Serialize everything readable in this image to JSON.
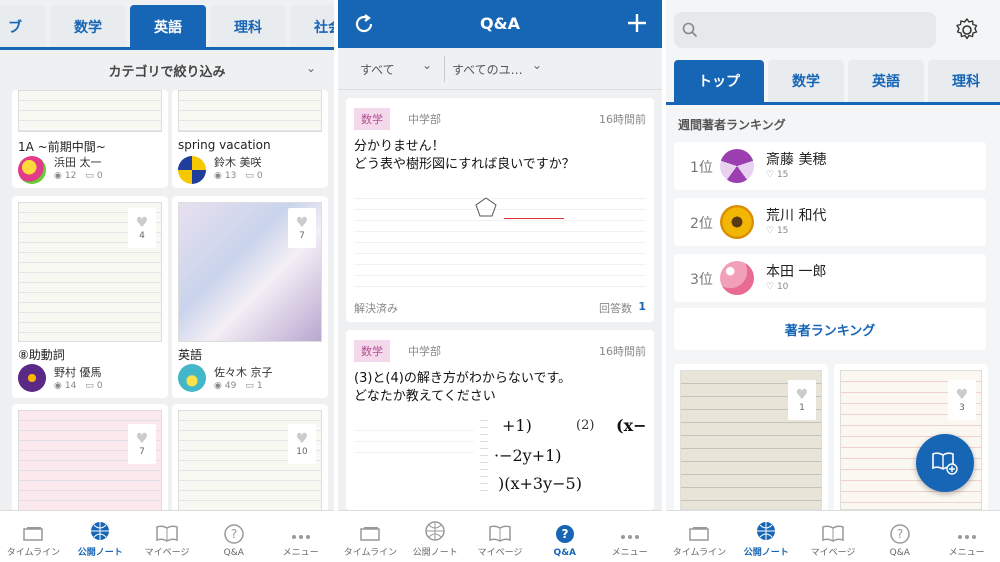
{
  "left_panel": {
    "tabs": [
      "ブ",
      "数学",
      "英語",
      "理科",
      "社会"
    ],
    "active_tab": 2,
    "filter_label": "カテゴリで絞り込み",
    "notes": [
      {
        "title": "1A ~前期中間~",
        "author": "浜田 太一",
        "views": "12",
        "comments": "0"
      },
      {
        "title": "spring vacation",
        "author": "鈴木 美咲",
        "views": "13",
        "comments": "0"
      },
      {
        "title": "⑧助動詞",
        "author": "野村 優馬",
        "views": "14",
        "comments": "0",
        "likes": "4"
      },
      {
        "title": "英語",
        "author": "佐々木 京子",
        "views": "49",
        "comments": "1",
        "likes": "7"
      },
      {
        "likes": "7"
      },
      {
        "likes": "10"
      }
    ]
  },
  "middle_panel": {
    "header_title": "Q&A",
    "filter_all": "すべて",
    "filter_all_users": "すべてのユ…",
    "questions": [
      {
        "subject": "数学",
        "level": "中学部",
        "time": "16時間前",
        "text_line1": "分かりません！",
        "text_line2": "どう表や樹形図にすれば良いですか？",
        "status": "解決済み",
        "answers_label": "回答数",
        "answers_count": "1"
      },
      {
        "subject": "数学",
        "level": "中学部",
        "time": "16時間前",
        "text_line1": "(3)と(4)の解き方がわからないです。",
        "text_line2": "どなたか教えてください",
        "math1": "+1)",
        "math2": "(2)",
        "math3": "(x−",
        "math4": "·−2y+1)",
        "math5": ")(x+3y−5)"
      }
    ]
  },
  "right_panel": {
    "tabs": [
      "トップ",
      "数学",
      "英語",
      "理科"
    ],
    "active_tab": 0,
    "section_title": "週間著者ランキング",
    "ranking": [
      {
        "rank": "1位",
        "name": "斎藤 美穂",
        "likes": "15"
      },
      {
        "rank": "2位",
        "name": "荒川 和代",
        "likes": "15"
      },
      {
        "rank": "3位",
        "name": "本田 一郎",
        "likes": "10"
      }
    ],
    "ranking_button": "著者ランキング",
    "note_likes": [
      "1",
      "3"
    ]
  },
  "bottom_nav": {
    "timeline": "タイムライン",
    "public_notes": "公開ノート",
    "mypage": "マイページ",
    "qa": "Q&A",
    "menu": "メニュー"
  },
  "colors": {
    "accent": "#1765b5",
    "subject_badge_bg": "#f4d9ec",
    "subject_badge_text": "#b24f91"
  }
}
